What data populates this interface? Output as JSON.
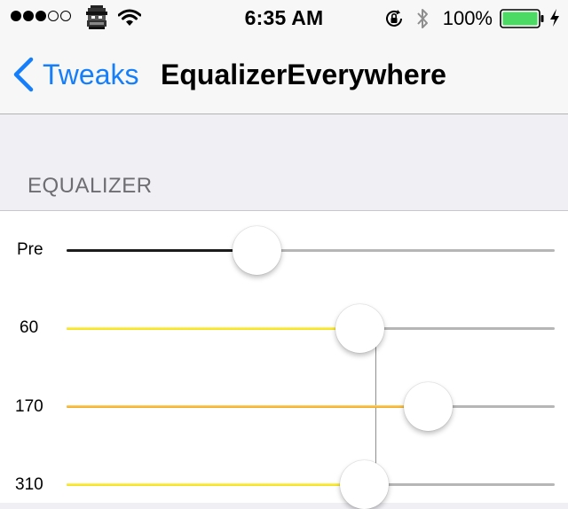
{
  "status_bar": {
    "signal_dots_full": 3,
    "signal_dots_empty": 2,
    "carrier_icon": "ghost-icon",
    "wifi_icon": "wifi-icon",
    "time": "6:35 AM",
    "orientation_lock_icon": "orientation-lock-icon",
    "bluetooth_icon": "bluetooth-icon",
    "battery_percent": "100%",
    "battery_icon": "battery-icon",
    "charging_icon": "charging-bolt-icon"
  },
  "navbar": {
    "back_label": "Tweaks",
    "title": "EqualizerEverywhere"
  },
  "section": {
    "header": "EQUALIZER"
  },
  "bands": [
    {
      "label": "Pre",
      "level": 0.39,
      "fill": "dark"
    },
    {
      "label": "60",
      "level": 0.6,
      "fill": "yellow"
    },
    {
      "label": "170",
      "level": 0.74,
      "fill": "orange"
    },
    {
      "label": "310",
      "level": 0.61,
      "fill": "yellow"
    }
  ],
  "colors": {
    "accent": "#147efb",
    "battery_fill": "#4cd964",
    "track_rest": "#b6b6b6",
    "fill_yellow": "#f3e000",
    "fill_orange": "#f0a81a",
    "fill_dark": "#1c1c1c",
    "section_header": "#6d6d72"
  }
}
